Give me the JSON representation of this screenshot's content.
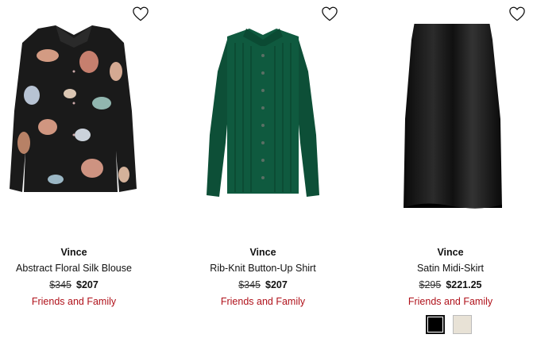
{
  "products": [
    {
      "brand": "Vince",
      "name": "Abstract Floral Silk Blouse",
      "original_price": "$345",
      "sale_price": "$207",
      "promo": "Friends and Family"
    },
    {
      "brand": "Vince",
      "name": "Rib-Knit Button-Up Shirt",
      "original_price": "$345",
      "sale_price": "$207",
      "promo": "Friends and Family"
    },
    {
      "brand": "Vince",
      "name": "Satin Midi-Skirt",
      "original_price": "$295",
      "sale_price": "$221.25",
      "promo": "Friends and Family",
      "swatches": [
        {
          "color": "#000000",
          "selected": true
        },
        {
          "color": "#e8e2d6",
          "selected": false
        }
      ]
    }
  ],
  "colors": {
    "promo": "#b0121b",
    "knit_green": "#0f5a3f",
    "satin_black": "#111111",
    "blouse_black": "#1a1a1a"
  },
  "icons": {
    "favorite": "heart-outline-icon"
  }
}
